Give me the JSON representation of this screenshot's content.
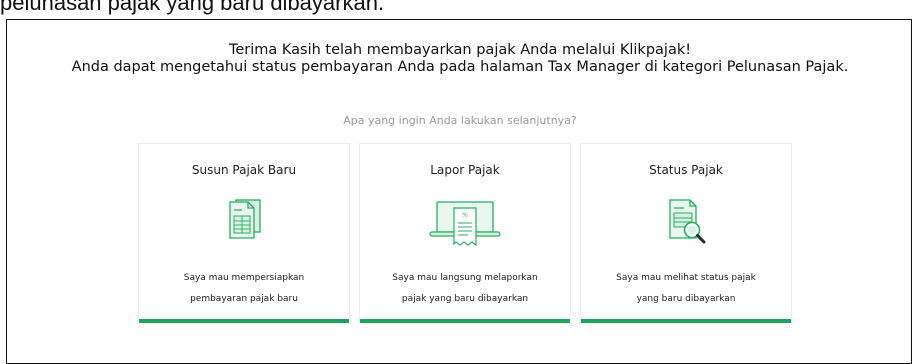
{
  "top_text": "pelunasan pajak yang baru dibayarkan.",
  "headline": {
    "line1": "Terima Kasih telah membayarkan pajak Anda melalui Klikpajak!",
    "line2": "Anda dapat mengetahui status pembayaran Anda pada halaman Tax Manager di kategori Pelunasan Pajak."
  },
  "question": "Apa yang ingin Anda lakukan selanjutnya?",
  "colors": {
    "accent": "#1fa45e",
    "icon_green": "#27ae60",
    "icon_light": "#d8f1e2"
  },
  "cards": [
    {
      "title": "Susun Pajak Baru",
      "icon": "document-stack-icon",
      "desc_line1": "Saya mau mempersiapkan",
      "desc_line2": "pembayaran pajak baru"
    },
    {
      "title": "Lapor Pajak",
      "icon": "laptop-receipt-icon",
      "desc_line1": "Saya mau langsung melaporkan",
      "desc_line2": "pajak yang baru dibayarkan"
    },
    {
      "title": "Status Pajak",
      "icon": "document-search-icon",
      "desc_line1": "Saya mau melihat status pajak",
      "desc_line2": "yang baru dibayarkan"
    }
  ]
}
